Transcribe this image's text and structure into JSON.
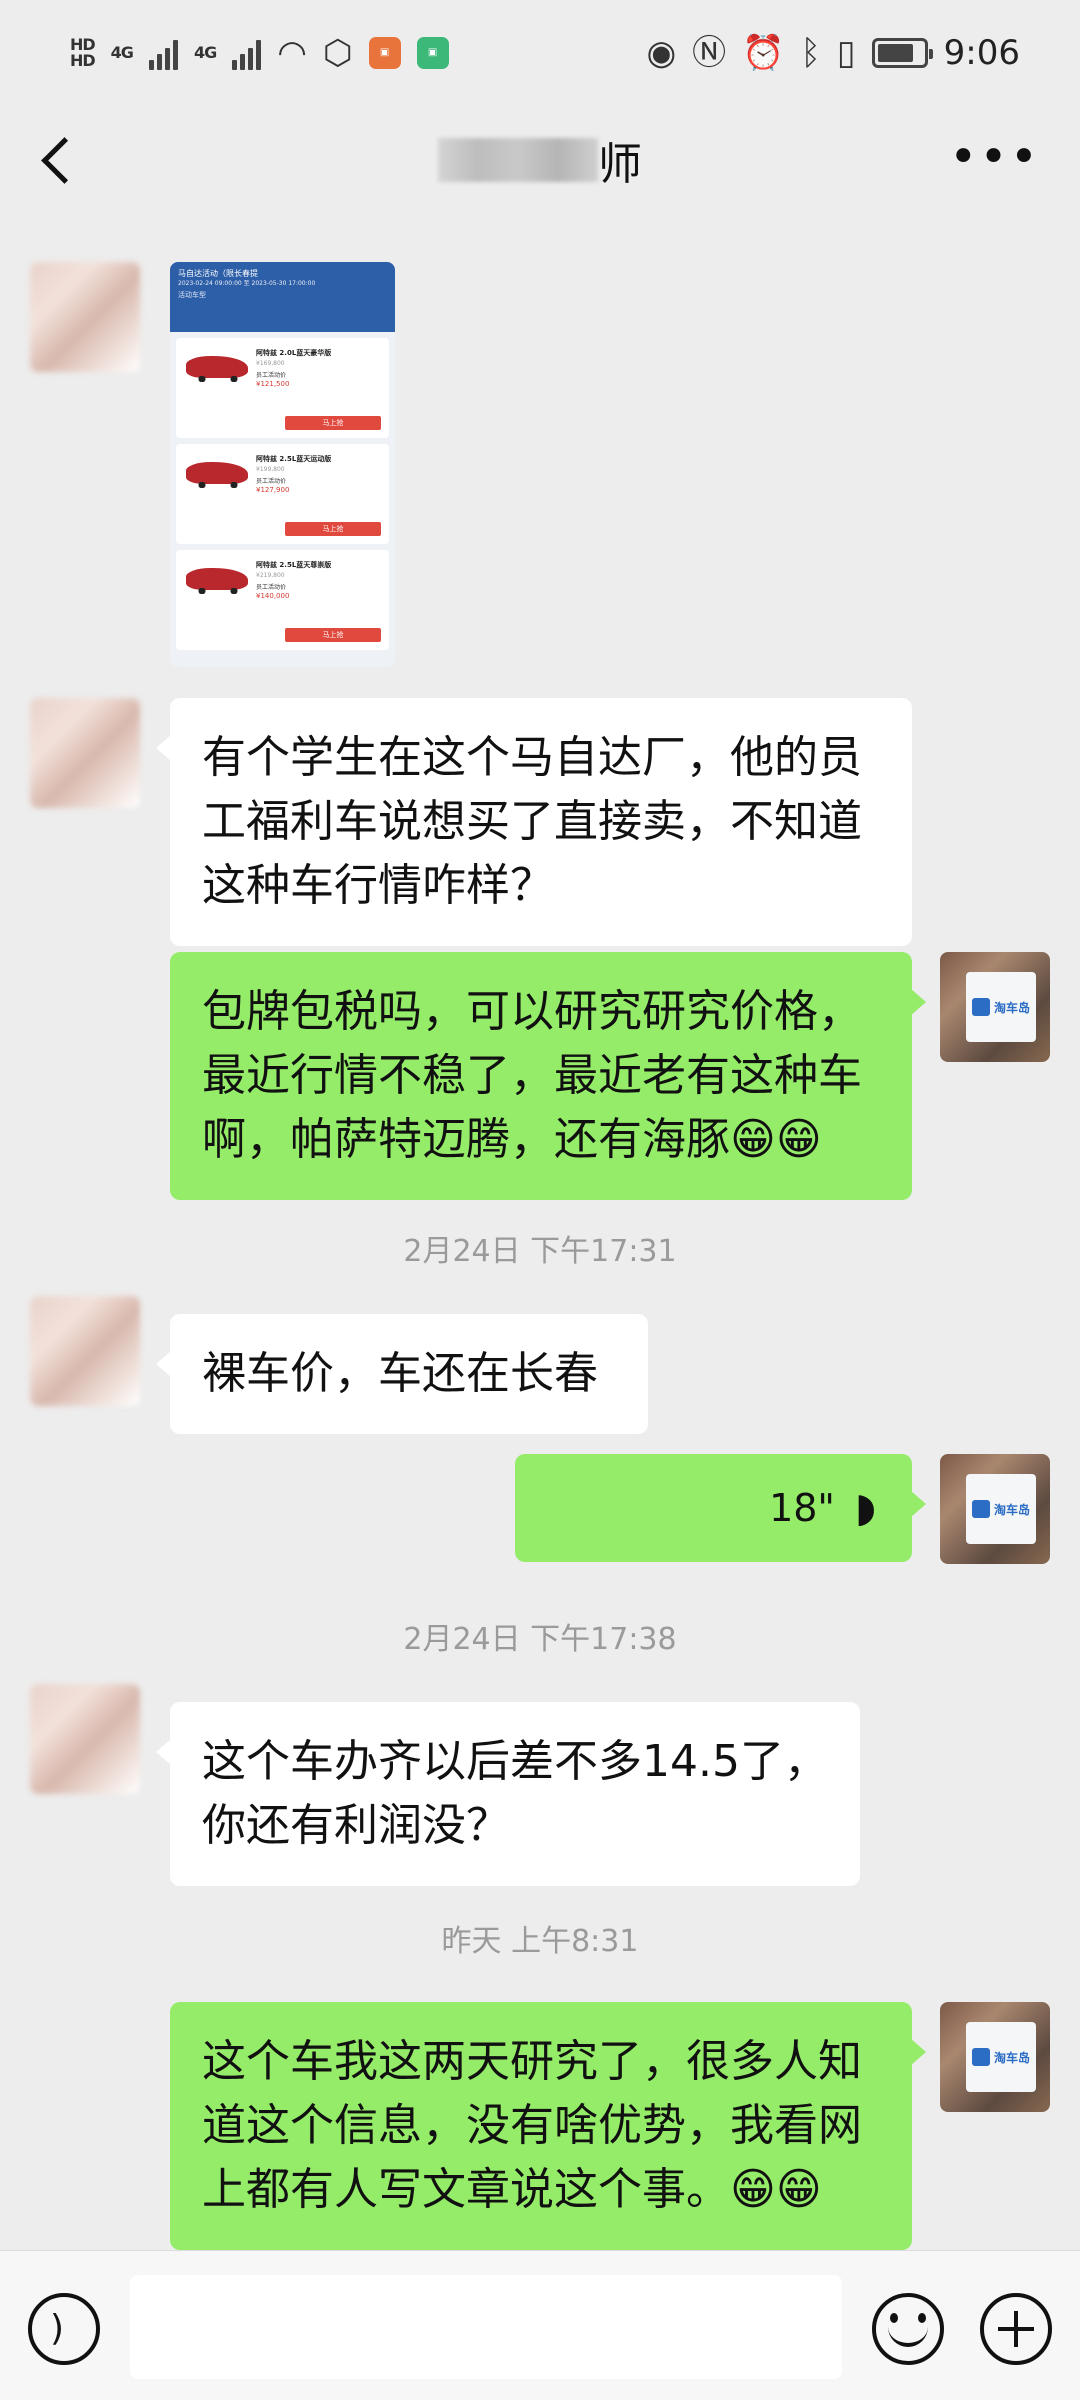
{
  "status_bar": {
    "network_1": "4G",
    "network_2": "4G",
    "time": "9:06"
  },
  "header": {
    "title_visible_char": "师"
  },
  "image_message": {
    "title": "马自达活动（限长春提",
    "date_range": "2023-02-24 09:00:00 至 2023-05-30 17:00:00",
    "section": "活动车型",
    "items": [
      {
        "name": "阿特兹 2.0L蓝天豪华版",
        "market": "¥169,800",
        "staff_label": "员工活动价",
        "price": "¥121,500",
        "button": "马上抢"
      },
      {
        "name": "阿特兹 2.5L蓝天运动版",
        "market": "¥199,800",
        "staff_label": "员工活动价",
        "price": "¥127,900",
        "button": "马上抢"
      },
      {
        "name": "阿特兹 2.5L蓝天尊崇版",
        "market": "¥219,800",
        "staff_label": "员工活动价",
        "price": "¥140,000",
        "button": "马上抢"
      }
    ]
  },
  "messages": [
    {
      "text": "有个学生在这个马自达厂，他的员工福利车说想买了直接卖，不知道这种车行情咋样？"
    },
    {
      "text": "包牌包税吗，可以研究研究价格，最近行情不稳了，最近老有这种车啊，帕萨特迈腾，还有海豚😁😁"
    },
    {
      "text": "裸车价，车还在长春"
    },
    {
      "voice_length": "18\""
    },
    {
      "text": "这个车办齐以后差不多14.5了，你还有利润没？"
    },
    {
      "text": "这个车我这两天研究了，很多人知道这个信息，没有啥优势，我看网上都有人写文章说这个事。😁😁"
    }
  ],
  "timestamps": [
    "2月24日 下午17:31",
    "2月24日 下午17:38",
    "昨天 上午8:31"
  ],
  "my_avatar_label": "淘车岛",
  "icons": {
    "back": "chevron-left-icon",
    "more": "more-dots-icon",
    "voice_toggle": "voice-icon",
    "emoji": "emoji-icon",
    "add": "plus-icon"
  },
  "colors": {
    "background": "#ededed",
    "bubble_self": "#95ec69",
    "bubble_other": "#ffffff",
    "timestamp": "#9a9a9a"
  }
}
